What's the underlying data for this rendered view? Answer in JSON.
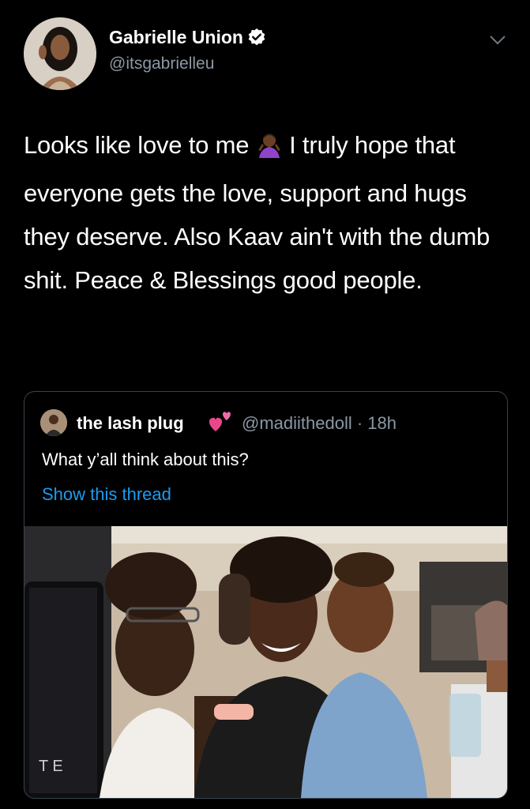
{
  "tweet": {
    "author_name": "Gabrielle Union",
    "author_handle": "@itsgabrielleu",
    "text_part1": "Looks like love to me ",
    "text_part2": " I truly hope that everyone gets the love, support and hugs they deserve. Also Kaav ain't with the dumb shit. Peace & Blessings good people."
  },
  "quoted": {
    "author_name": "the lash plug",
    "author_handle": "@madiithedoll · 18h",
    "text": "What y’all think about this?",
    "show_thread_label": "Show this thread",
    "photo_text": "T E"
  },
  "colors": {
    "background": "#000000",
    "secondary_text": "#8b98a5",
    "link": "#1d9bf0",
    "border": "#38444d"
  },
  "icons": {
    "verified": "verified-badge-icon",
    "more": "chevron-down-icon",
    "emoji1": "person-shrugging-emoji",
    "emoji2": "two-hearts-emoji"
  }
}
